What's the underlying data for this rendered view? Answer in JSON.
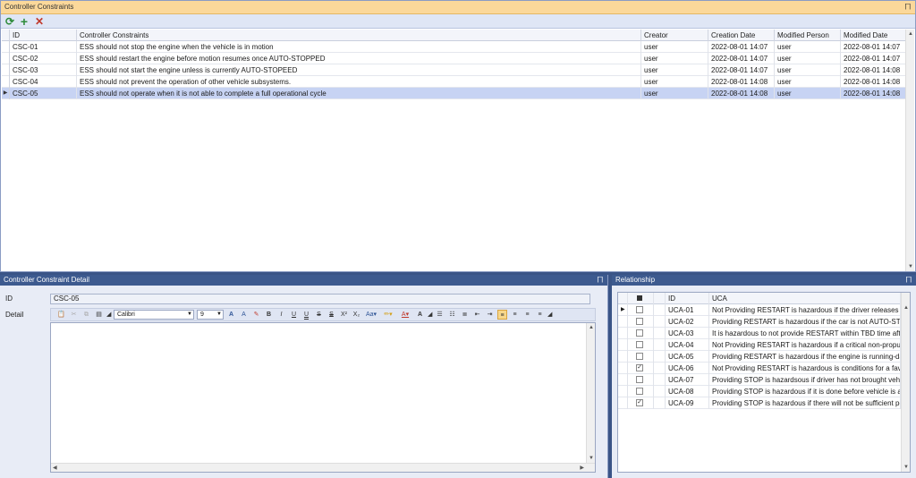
{
  "top": {
    "title": "Controller Constraints",
    "pin": "⨅",
    "toolbar": {
      "refresh": "⟳",
      "add": "+",
      "delete": "✕"
    },
    "columns": [
      "ID",
      "Controller Constraints",
      "Creator",
      "Creation Date",
      "Modified Person",
      "Modified Date"
    ],
    "rows": [
      [
        "CSC-01",
        "ESS should not stop the engine when the vehicle is in motion",
        "user",
        "2022-08-01 14:07",
        "user",
        "2022-08-01 14:07"
      ],
      [
        "CSC-02",
        "ESS should restart the engine before motion resumes once AUTO-STOPPED",
        "user",
        "2022-08-01 14:07",
        "user",
        "2022-08-01 14:07"
      ],
      [
        "CSC-03",
        "ESS should not start the engine unless is currently AUTO-STOPEED",
        "user",
        "2022-08-01 14:07",
        "user",
        "2022-08-01 14:08"
      ],
      [
        "CSC-04",
        "ESS should not prevent the operation of other vehicle subsystems.",
        "user",
        "2022-08-01 14:08",
        "user",
        "2022-08-01 14:08"
      ],
      [
        "CSC-05",
        "ESS should not operate when it is not able to complete a full operational cycle",
        "user",
        "2022-08-01 14:08",
        "user",
        "2022-08-01 14:08"
      ]
    ],
    "selected_row": 4
  },
  "detail": {
    "title": "Controller Constraint Detail",
    "id_label": "ID",
    "id_value": "CSC-05",
    "detail_label": "Detail",
    "font_name": "Calibri",
    "font_size": "9"
  },
  "relationship": {
    "title": "Relationship",
    "columns": [
      "ID",
      "UCA"
    ],
    "rows": [
      {
        "id": "UCA-01",
        "uca": "Not Providing RESTART is hazardous if the driver releases the...",
        "checked": false
      },
      {
        "id": "UCA-02",
        "uca": "Providing RESTART is hazardous if the car is not AUTO-STOPP...",
        "checked": false
      },
      {
        "id": "UCA-03",
        "uca": "It is hazardous to not provide RESTART within TBD time after...",
        "checked": false
      },
      {
        "id": "UCA-04",
        "uca": "Not Providing RESTART is hazardous if a critical non-propulsi...",
        "checked": false
      },
      {
        "id": "UCA-05",
        "uca": "Providing RESTART is hazardous if the engine is running-dam...",
        "checked": false
      },
      {
        "id": "UCA-06",
        "uca": "Not Providing RESTART is hazardous is conditions for a favora...",
        "checked": true
      },
      {
        "id": "UCA-07",
        "uca": "Providing STOP is hazardsous if driver has not brought vehicl...",
        "checked": false
      },
      {
        "id": "UCA-08",
        "uca": "Providing STOP is hazardous if it is done before vehicle is at r...",
        "checked": false
      },
      {
        "id": "UCA-09",
        "uca": "Providing STOP is hazardous if there will not be sufficient po...",
        "checked": true
      }
    ]
  },
  "colors": {
    "accent": "#3d5a8f",
    "selected": "#c7d3f3",
    "header": "#fbd89a"
  }
}
